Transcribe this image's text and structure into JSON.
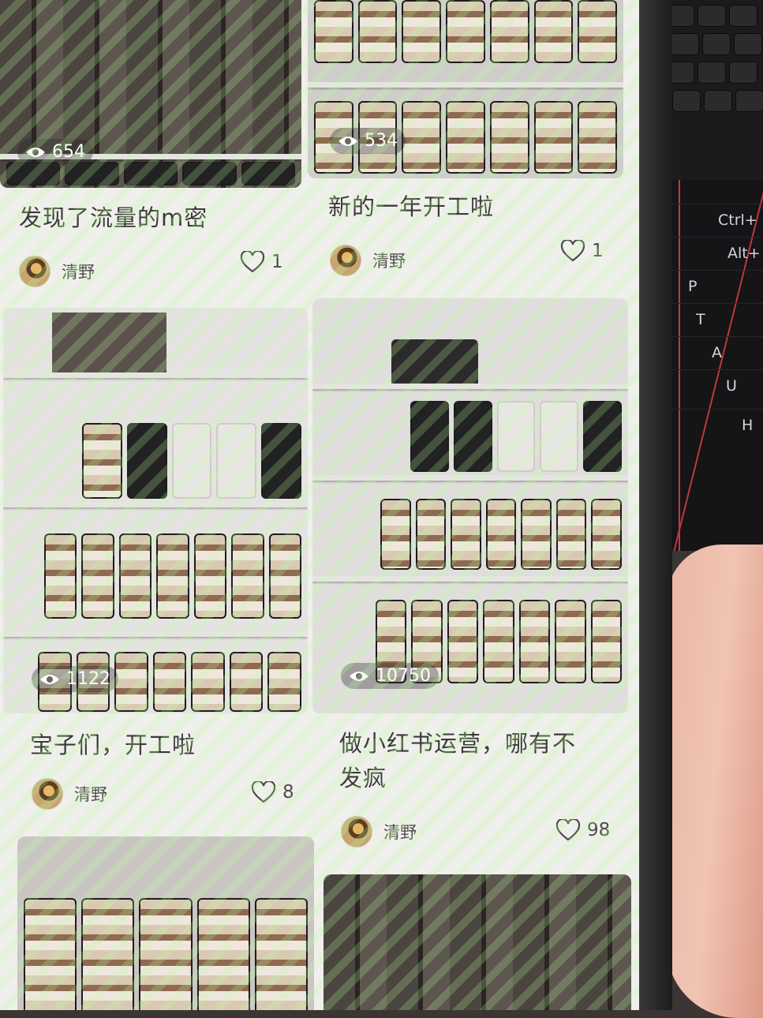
{
  "feed": {
    "cards": [
      {
        "views": "654",
        "title": "发现了流量的m密",
        "author": "清野",
        "likes": "1"
      },
      {
        "views": "534",
        "title": "新的一年开工啦",
        "author": "清野",
        "likes": "1"
      },
      {
        "views": "1122",
        "title": "宝子们，开工啦",
        "author": "清野",
        "likes": "8"
      },
      {
        "views": "10750",
        "title_line1": "做小红书运营，哪有不",
        "title_line2": "发疯",
        "author": "清野",
        "likes": "98"
      }
    ]
  },
  "background_keys": [
    "Ctrl+",
    "Alt+",
    "P",
    "T",
    "A",
    "U",
    "H"
  ],
  "icons": {
    "views": "eye-icon",
    "likes": "heart-icon"
  },
  "colors": {
    "screen_bg": "#efefec",
    "text": "#3a3a38"
  }
}
